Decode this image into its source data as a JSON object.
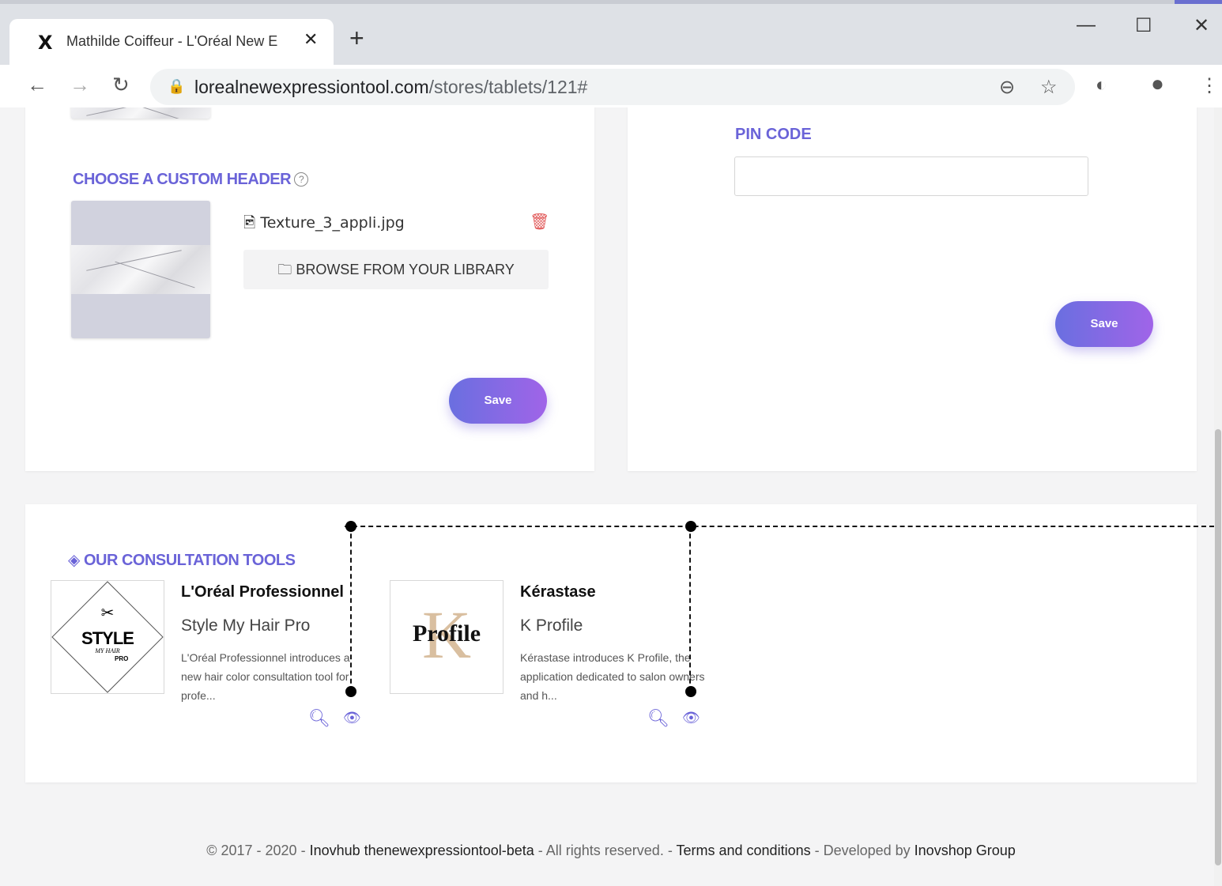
{
  "browser": {
    "tab_title": "Mathilde Coiffeur - L'Oréal New E",
    "tab_favicon": "X",
    "new_tab": "+",
    "url_domain": "lorealnewexpressiontool.com",
    "url_path": "/stores/tablets/121#"
  },
  "header_card": {
    "title": "CHOOSE A CUSTOM HEADER",
    "help": "?",
    "file_name": "Texture_3_appli.jpg",
    "browse_label": "BROWSE FROM YOUR LIBRARY",
    "save_label": "Save"
  },
  "pin_card": {
    "label": "PIN CODE",
    "value": "",
    "save_label": "Save"
  },
  "tools": {
    "title": "OUR CONSULTATION TOOLS",
    "items": [
      {
        "brand": "L'Oréal Professionnel",
        "name": "Style My Hair Pro",
        "desc": "L'Oréal Professionnel introduces a new hair color consultation tool for profe...",
        "logo_text": "STYLE",
        "logo_sub": "MY HAIR",
        "logo_tag": "PRO"
      },
      {
        "brand": "Kérastase",
        "name": "K Profile",
        "desc": "Kérastase introduces K Profile, the application dedicated to salon owners and h...",
        "logo_text": "Profile",
        "logo_letter": "K"
      }
    ]
  },
  "footer": {
    "copyright": "© 2017 - 2020 - ",
    "brand": "Inovhub thenewexpressiontool-beta",
    "rights": " - All rights reserved. - ",
    "terms": "Terms and conditions",
    "dev": " - Developed by ",
    "dev_name": "Inovshop Group"
  },
  "colors": {
    "accent": "#6a63d8",
    "delete": "#e25c5c"
  }
}
